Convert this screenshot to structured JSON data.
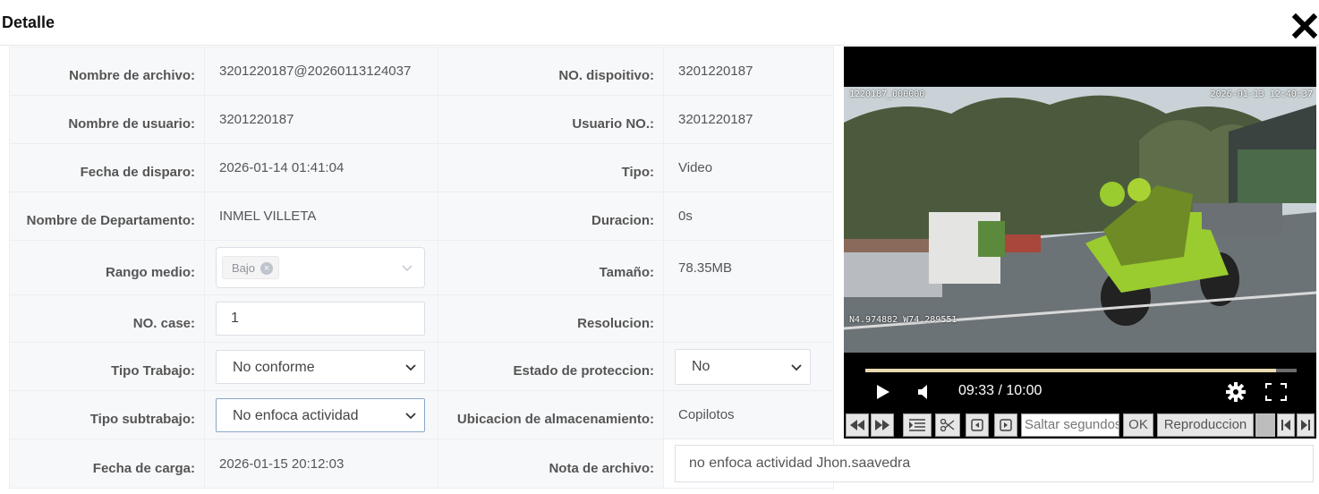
{
  "dialog": {
    "title": "Detalle",
    "close_icon": "close-icon"
  },
  "rows": {
    "archivo": {
      "label": "Nombre de archivo:",
      "value": "3201220187@20260113124037"
    },
    "dispositivo": {
      "label": "NO. dispoitivo:",
      "value": "3201220187"
    },
    "usuario": {
      "label": "Nombre de usuario:",
      "value": "3201220187"
    },
    "usuario_no": {
      "label": "Usuario NO.:",
      "value": "3201220187"
    },
    "fecha_disparo": {
      "label": "Fecha de disparo:",
      "value": "2026-01-14 01:41:04"
    },
    "tipo": {
      "label": "Tipo:",
      "value": "Video"
    },
    "departamento": {
      "label": "Nombre de Departamento:",
      "value": "INMEL VILLETA"
    },
    "duracion": {
      "label": "Duracion:",
      "value": "0s"
    },
    "rango": {
      "label": "Rango medio:",
      "tag": "Bajo"
    },
    "tamano": {
      "label": "Tamaño:",
      "value": "78.35MB"
    },
    "case": {
      "label": "NO. case:",
      "value": "1"
    },
    "resolucion": {
      "label": "Resolucion:",
      "value": ""
    },
    "tipo_trabajo": {
      "label": "Tipo Trabajo:",
      "value": "No conforme"
    },
    "estado": {
      "label": "Estado de proteccion:",
      "value": "No"
    },
    "tipo_subtrabajo": {
      "label": "Tipo subtrabajo:",
      "value": "No enfoca actividad"
    },
    "ubicacion": {
      "label": "Ubicacion de almacenamiento:",
      "value": "Copilotos"
    },
    "fecha_carga": {
      "label": "Fecha de carga:",
      "value": "2026-01-15 20:12:03"
    },
    "nota": {
      "label": "Nota de archivo:",
      "value": "no enfoca actividad Jhon.saavedra"
    }
  },
  "player": {
    "osd_top_left": "1220187_000000",
    "osd_top_right": "2026-01-13 12:40:37",
    "osd_bottom_left": "N4.974882 W74.289551",
    "time": "09:33 / 10:00",
    "progress_fraction": 0.953,
    "colors": {
      "progress": "#e8d9b1"
    }
  },
  "toolbar": {
    "seek_placeholder": "Saltar segundos",
    "ok_label": "OK",
    "play_label": "Reproduccion"
  }
}
